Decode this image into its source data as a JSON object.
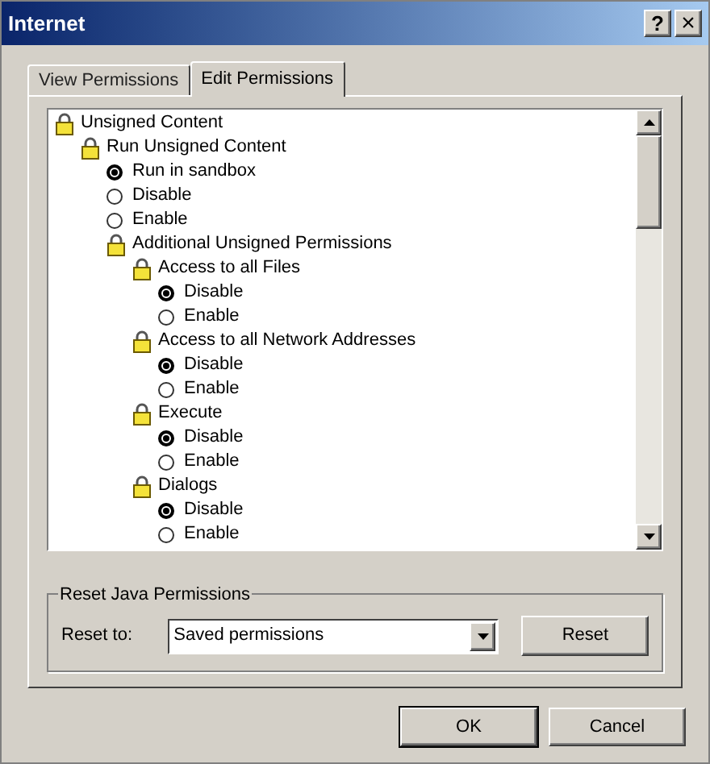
{
  "window": {
    "title": "Internet",
    "help_button": "?",
    "close_button": "×"
  },
  "tabs": [
    {
      "label": "View Permissions",
      "selected": false
    },
    {
      "label": "Edit Permissions",
      "selected": true
    }
  ],
  "tree": [
    {
      "kind": "group",
      "label": "Unsigned Content",
      "children": [
        {
          "kind": "group",
          "label": "Run Unsigned Content",
          "children": [
            {
              "kind": "option",
              "label": "Run in sandbox",
              "selected": true
            },
            {
              "kind": "option",
              "label": "Disable",
              "selected": false
            },
            {
              "kind": "option",
              "label": "Enable",
              "selected": false
            },
            {
              "kind": "group",
              "label": "Additional Unsigned Permissions",
              "children": [
                {
                  "kind": "group",
                  "label": "Access to all Files",
                  "children": [
                    {
                      "kind": "option",
                      "label": "Disable",
                      "selected": true
                    },
                    {
                      "kind": "option",
                      "label": "Enable",
                      "selected": false
                    }
                  ]
                },
                {
                  "kind": "group",
                  "label": "Access to all Network Addresses",
                  "children": [
                    {
                      "kind": "option",
                      "label": "Disable",
                      "selected": true
                    },
                    {
                      "kind": "option",
                      "label": "Enable",
                      "selected": false
                    }
                  ]
                },
                {
                  "kind": "group",
                  "label": "Execute",
                  "children": [
                    {
                      "kind": "option",
                      "label": "Disable",
                      "selected": true
                    },
                    {
                      "kind": "option",
                      "label": "Enable",
                      "selected": false
                    }
                  ]
                },
                {
                  "kind": "group",
                  "label": "Dialogs",
                  "children": [
                    {
                      "kind": "option",
                      "label": "Disable",
                      "selected": true
                    },
                    {
                      "kind": "option",
                      "label": "Enable",
                      "selected": false
                    }
                  ]
                }
              ]
            }
          ]
        }
      ]
    }
  ],
  "reset_group": {
    "title": "Reset Java Permissions",
    "label": "Reset to:",
    "value": "Saved permissions",
    "button": "Reset"
  },
  "buttons": [
    "OK",
    "Cancel"
  ]
}
